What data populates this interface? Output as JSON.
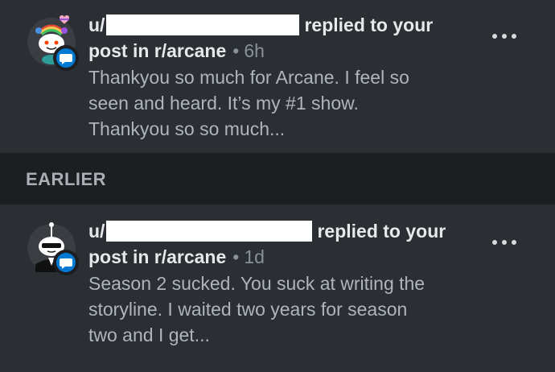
{
  "notifications": [
    {
      "user_prefix": "u/",
      "action_text": "replied to your",
      "context_text": "post in r/arcane",
      "time": "6h",
      "body_lines": [
        "Thankyou so much for Arcane. I feel so",
        "seen and heard. It’s my #1 show.",
        "Thankyou so so much..."
      ]
    },
    {
      "user_prefix": "u/",
      "action_text": "replied to your",
      "context_text": "post in r/arcane",
      "time": "1d",
      "body_lines": [
        "Season 2 sucked. You suck at writing the",
        "storyline. I waited two years for season",
        "two and I get..."
      ]
    }
  ],
  "section": {
    "title": "EARLIER"
  },
  "icons": {
    "avatar": "snoo-avatar",
    "badge": "chat-bubble-icon",
    "more": "more-options-icon"
  },
  "colors": {
    "background": "#23262a",
    "card": "#2b2e32",
    "section": "#1c1e21",
    "badge": "#0079d3"
  }
}
